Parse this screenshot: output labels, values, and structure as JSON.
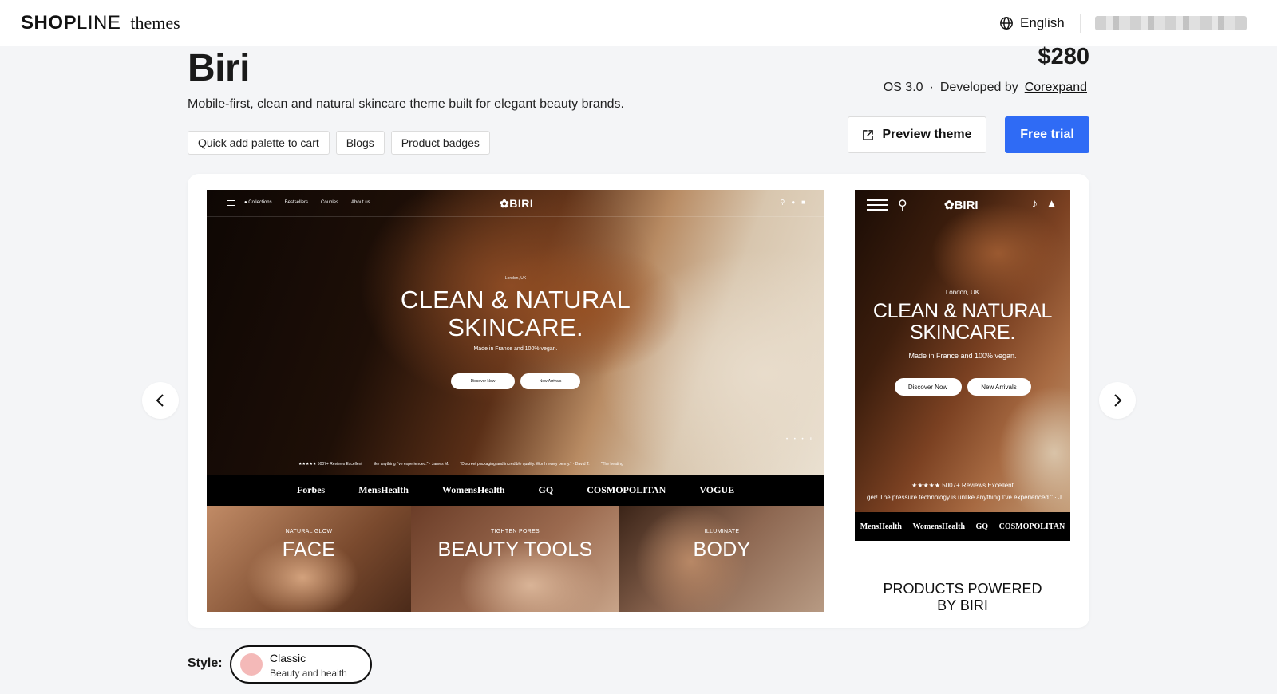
{
  "topbar": {
    "brand_bold": "SHOP",
    "brand_rest": "LINE",
    "brand_sub": "themes",
    "language": "English"
  },
  "theme": {
    "name": "Biri",
    "description": "Mobile-first, clean and natural skincare theme built for elegant beauty brands.",
    "price": "$280",
    "os": "OS 3.0",
    "developed_by_label": "Developed by",
    "developer": "Corexpand",
    "tags": [
      "Quick add palette to cart",
      "Blogs",
      "Product badges"
    ]
  },
  "actions": {
    "preview_label": "Preview theme",
    "trial_label": "Free trial"
  },
  "desktop_preview": {
    "nav_links": [
      "● Collections",
      "Bestsellers",
      "Couples",
      "About us"
    ],
    "logo": "✿BIRI",
    "location": "London, UK",
    "headline_1": "CLEAN & NATURAL",
    "headline_2": "SKINCARE.",
    "subline": "Made in France and 100% vegan.",
    "btn_discover": "Discover Now",
    "btn_arrivals": "New Arrivals",
    "reviews": "★★★★★  5007+ Reviews  Excellent",
    "quote_1": "like anything I've experienced.\" · James M.",
    "quote_2": "\"Discreet packaging and incredible quality. Worth every penny.\" · David T.",
    "quote_3": "\"The heating",
    "press": [
      "Forbes",
      "MensHealth",
      "WomensHealth",
      "GQ",
      "COSMOPOLITAN",
      "VOGUE"
    ],
    "tiles": [
      {
        "label": "NATURAL GLOW",
        "title": "FACE"
      },
      {
        "label": "TIGHTEN PORES",
        "title": "BEAUTY TOOLS"
      },
      {
        "label": "ILLUMINATE",
        "title": "BODY"
      }
    ]
  },
  "mobile_preview": {
    "logo": "✿BIRI",
    "location": "London, UK",
    "headline_1": "CLEAN & NATURAL",
    "headline_2": "SKINCARE.",
    "subline": "Made in France and 100% vegan.",
    "btn_discover": "Discover Now",
    "btn_arrivals": "New Arrivals",
    "reviews": "★★★★★  5007+ Reviews  Excellent",
    "quote": "ger! The pressure technology is unlike anything I've experienced.\" · J",
    "press": [
      "MensHealth",
      "WomensHealth",
      "GQ",
      "COSMOPOLITAN"
    ],
    "products_heading_1": "PRODUCTS POWERED",
    "products_heading_2": "BY BIRI"
  },
  "style": {
    "label": "Style:",
    "name": "Classic",
    "description": "Beauty and health",
    "swatch_color": "#f4b9b8"
  },
  "colors": {
    "accent": "#2f6bf5",
    "background": "#f4f5f7"
  }
}
